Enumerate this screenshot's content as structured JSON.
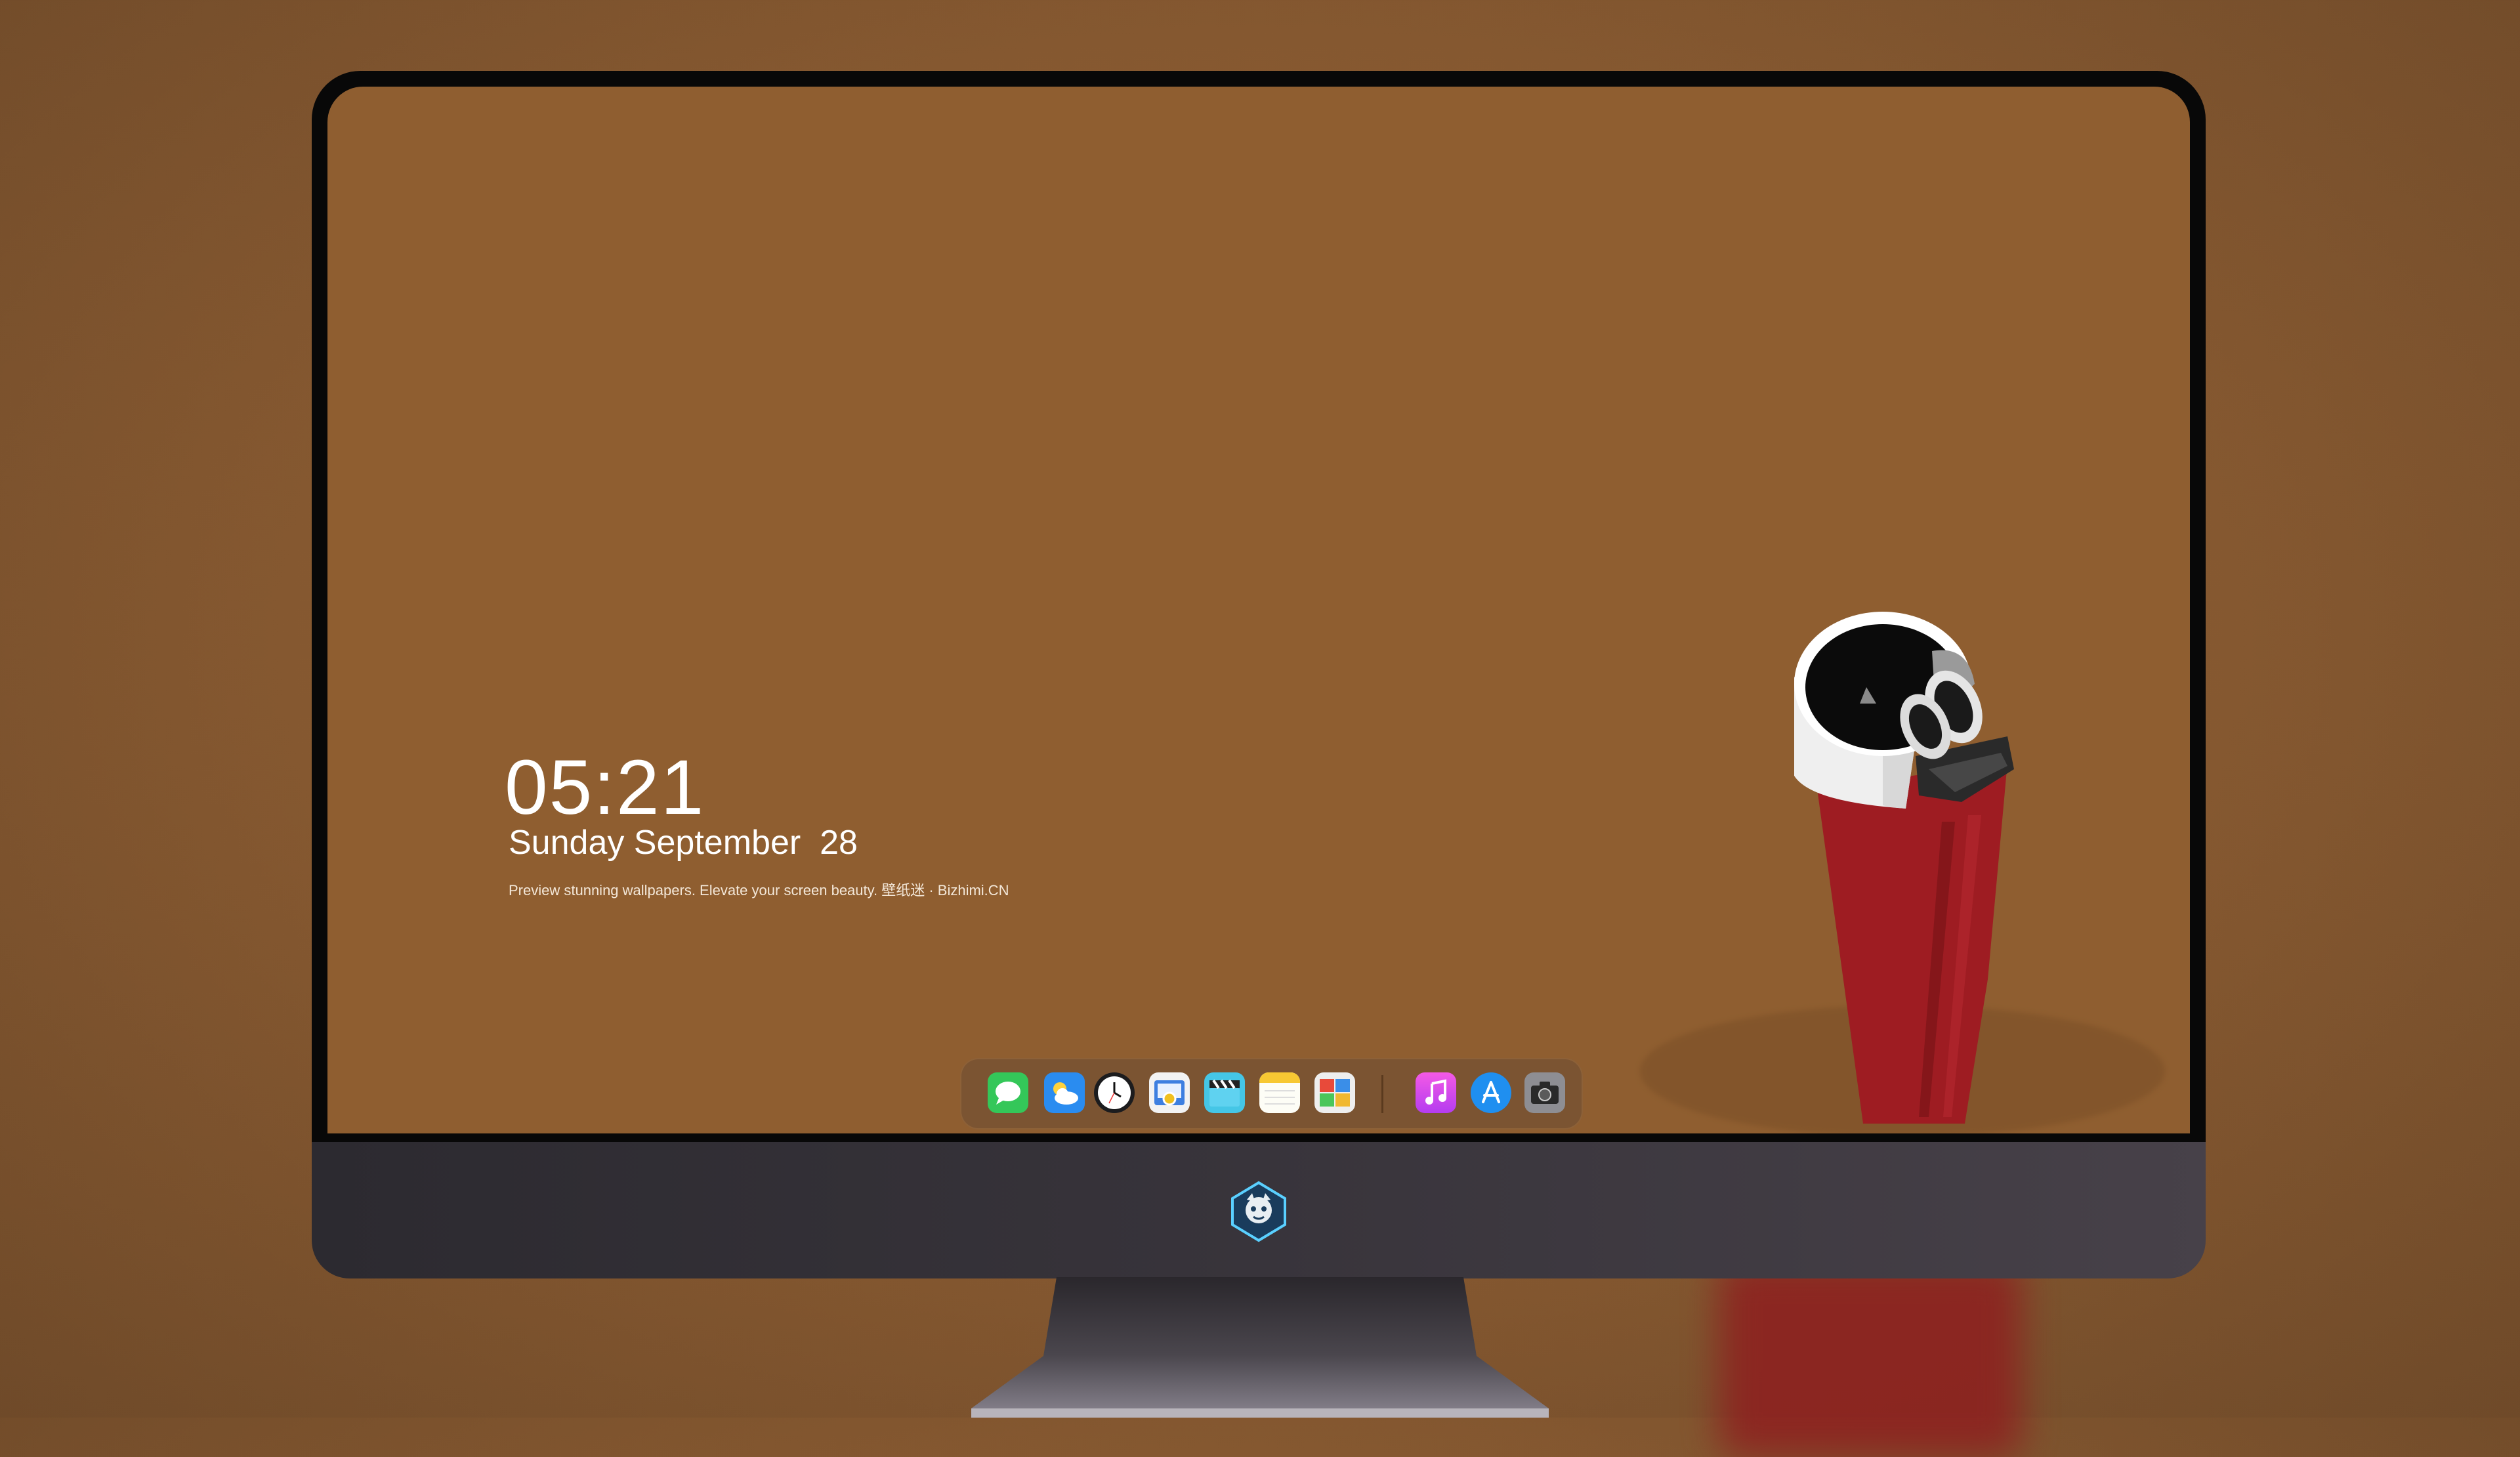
{
  "lockscreen": {
    "time": "05:21",
    "date": "Sunday September  28",
    "tagline": "Preview stunning wallpapers. Elevate your screen beauty. 壁纸迷 · Bizhimi.CN"
  },
  "dock": {
    "items": [
      {
        "name": "messages-icon"
      },
      {
        "name": "weather-icon"
      },
      {
        "name": "clock-icon"
      },
      {
        "name": "preview-icon"
      },
      {
        "name": "clapper-icon"
      },
      {
        "name": "notes-icon"
      },
      {
        "name": "photo-booth-icon"
      },
      {
        "name": "music-icon"
      },
      {
        "name": "app-store-icon"
      },
      {
        "name": "camera-icon"
      }
    ]
  },
  "colors": {
    "wallpaper": "#8f5e30",
    "lighter_red": "#9e1c22"
  }
}
